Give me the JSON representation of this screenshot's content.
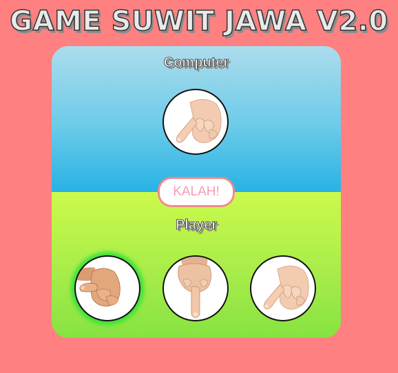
{
  "game": {
    "title": "GAME SUWIT JAWA V2.0"
  },
  "computer": {
    "label": "Computer",
    "choice_icon": "little-finger-hand-icon"
  },
  "result": {
    "text": "KALAH!"
  },
  "player": {
    "label": "Player",
    "options": [
      {
        "icon": "thumb-hand-icon",
        "selected": true
      },
      {
        "icon": "index-finger-hand-icon",
        "selected": false
      },
      {
        "icon": "little-finger-hand-icon",
        "selected": false
      }
    ]
  },
  "colors": {
    "background": "#ff8080",
    "computer_area": "#27b2e4",
    "player_area": "#a8ec4a",
    "result_border": "#f28a8a",
    "result_text": "#f79ab6",
    "selected_glow": "#3fe23a"
  }
}
